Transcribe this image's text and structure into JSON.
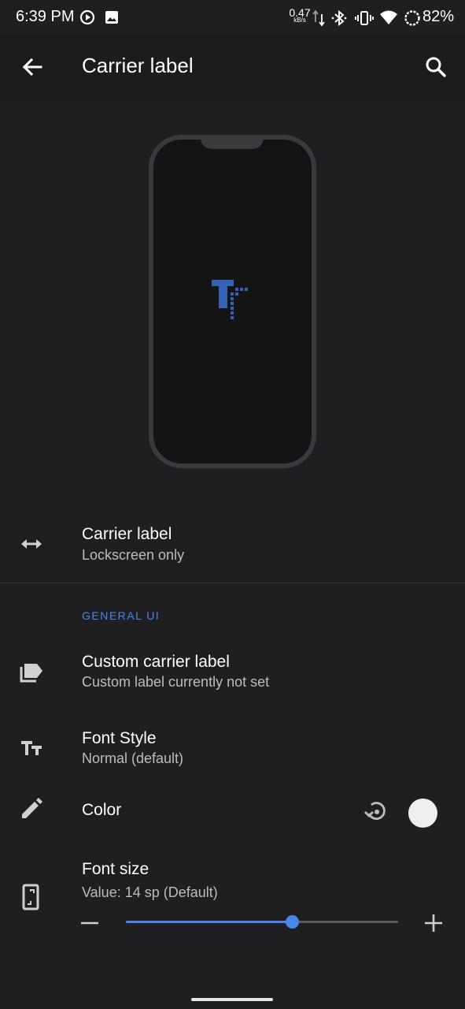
{
  "status_bar": {
    "time": "6:39 PM",
    "net_speed_value": "0.47",
    "net_speed_unit": "kB/s",
    "battery": "82%"
  },
  "app_bar": {
    "title": "Carrier label",
    "back_icon": "arrow-back-icon",
    "search_icon": "search-icon"
  },
  "preview": {
    "logo_icon": "tt-logo-icon",
    "logo_color": "#3561b8"
  },
  "items": {
    "carrier_label": {
      "title": "Carrier label",
      "summary": "Lockscreen only",
      "icon": "swap-horizontal-icon"
    },
    "custom_label": {
      "title": "Custom carrier label",
      "summary": "Custom label currently not set",
      "icon": "label-icon"
    },
    "font_style": {
      "title": "Font Style",
      "summary": "Normal (default)",
      "icon": "text-fields-icon"
    },
    "color": {
      "title": "Color",
      "icon": "pencil-icon",
      "reset_icon": "restore-icon",
      "swatch_color": "#eeeeee"
    },
    "font_size": {
      "title": "Font size",
      "summary": "Value: 14 sp (Default)",
      "icon": "phone-resize-icon",
      "slider_fraction": 0.61
    }
  },
  "section": {
    "general_ui": "GENERAL UI"
  },
  "colors": {
    "background": "#1f1f22",
    "accent": "#4a86e8",
    "secondary_text": "#bdbdbd"
  }
}
